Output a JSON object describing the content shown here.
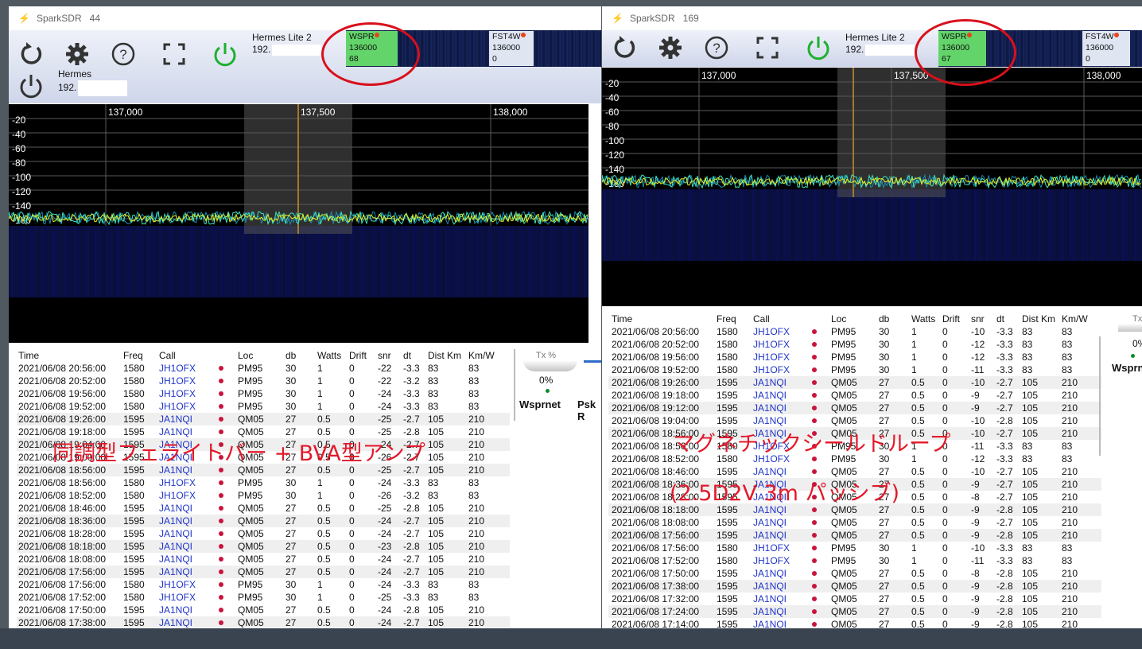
{
  "left": {
    "title": "SparkSDR",
    "title_num": "44",
    "radio1": {
      "name": "Hermes Lite 2",
      "ip": "192."
    },
    "radio2": {
      "name": "Hermes",
      "ip": "192."
    },
    "wspr": {
      "mode": "WSPR",
      "freq": "136000",
      "count": "68"
    },
    "fst4w": {
      "mode": "FST4W",
      "freq": "136000",
      "count": "0"
    },
    "freq_labels": [
      "137,000",
      "137,500",
      "138,000"
    ],
    "db_labels": [
      "-20",
      "-40",
      "-60",
      "-80",
      "-100",
      "-120",
      "-140",
      "-160"
    ],
    "headers": [
      "Time",
      "Freq",
      "Call",
      "Loc",
      "db",
      "Watts",
      "Drift",
      "snr",
      "dt",
      "Dist Km",
      "Km/W"
    ],
    "rows": [
      [
        "2021/06/08 20:56:00",
        "1580",
        "JH1OFX",
        "PM95",
        "30",
        "1",
        "0",
        "-22",
        "-3.3",
        "83",
        "83"
      ],
      [
        "2021/06/08 20:52:00",
        "1580",
        "JH1OFX",
        "PM95",
        "30",
        "1",
        "0",
        "-22",
        "-3.2",
        "83",
        "83"
      ],
      [
        "2021/06/08 19:56:00",
        "1580",
        "JH1OFX",
        "PM95",
        "30",
        "1",
        "0",
        "-24",
        "-3.3",
        "83",
        "83"
      ],
      [
        "2021/06/08 19:52:00",
        "1580",
        "JH1OFX",
        "PM95",
        "30",
        "1",
        "0",
        "-24",
        "-3.3",
        "83",
        "83"
      ],
      [
        "2021/06/08 19:26:00",
        "1595",
        "JA1NQI",
        "QM05",
        "27",
        "0.5",
        "0",
        "-25",
        "-2.7",
        "105",
        "210"
      ],
      [
        "2021/06/08 19:18:00",
        "1595",
        "JA1NQI",
        "QM05",
        "27",
        "0.5",
        "0",
        "-25",
        "-2.8",
        "105",
        "210"
      ],
      [
        "2021/06/08 19:04:00",
        "1595",
        "JA1NQI",
        "QM05",
        "27",
        "0.5",
        "0",
        "-24",
        "-2.7",
        "105",
        "210"
      ],
      [
        "2021/06/08 19:00:00",
        "1595",
        "JA1NQI",
        "QM05",
        "27",
        "0.5",
        "0",
        "-26",
        "-2.7",
        "105",
        "210"
      ],
      [
        "2021/06/08 18:56:00",
        "1595",
        "JA1NQI",
        "QM05",
        "27",
        "0.5",
        "0",
        "-25",
        "-2.7",
        "105",
        "210"
      ],
      [
        "2021/06/08 18:56:00",
        "1580",
        "JH1OFX",
        "PM95",
        "30",
        "1",
        "0",
        "-24",
        "-3.3",
        "83",
        "83"
      ],
      [
        "2021/06/08 18:52:00",
        "1580",
        "JH1OFX",
        "PM95",
        "30",
        "1",
        "0",
        "-26",
        "-3.2",
        "83",
        "83"
      ],
      [
        "2021/06/08 18:46:00",
        "1595",
        "JA1NQI",
        "QM05",
        "27",
        "0.5",
        "0",
        "-25",
        "-2.8",
        "105",
        "210"
      ],
      [
        "2021/06/08 18:36:00",
        "1595",
        "JA1NQI",
        "QM05",
        "27",
        "0.5",
        "0",
        "-24",
        "-2.7",
        "105",
        "210"
      ],
      [
        "2021/06/08 18:28:00",
        "1595",
        "JA1NQI",
        "QM05",
        "27",
        "0.5",
        "0",
        "-24",
        "-2.7",
        "105",
        "210"
      ],
      [
        "2021/06/08 18:18:00",
        "1595",
        "JA1NQI",
        "QM05",
        "27",
        "0.5",
        "0",
        "-23",
        "-2.8",
        "105",
        "210"
      ],
      [
        "2021/06/08 18:08:00",
        "1595",
        "JA1NQI",
        "QM05",
        "27",
        "0.5",
        "0",
        "-24",
        "-2.7",
        "105",
        "210"
      ],
      [
        "2021/06/08 17:56:00",
        "1595",
        "JA1NQI",
        "QM05",
        "27",
        "0.5",
        "0",
        "-24",
        "-2.7",
        "105",
        "210"
      ],
      [
        "2021/06/08 17:56:00",
        "1580",
        "JH1OFX",
        "PM95",
        "30",
        "1",
        "0",
        "-24",
        "-3.3",
        "83",
        "83"
      ],
      [
        "2021/06/08 17:52:00",
        "1580",
        "JH1OFX",
        "PM95",
        "30",
        "1",
        "0",
        "-25",
        "-3.3",
        "83",
        "83"
      ],
      [
        "2021/06/08 17:50:00",
        "1595",
        "JA1NQI",
        "QM05",
        "27",
        "0.5",
        "0",
        "-24",
        "-2.8",
        "105",
        "210"
      ],
      [
        "2021/06/08 17:38:00",
        "1595",
        "JA1NQI",
        "QM05",
        "27",
        "0.5",
        "0",
        "-24",
        "-2.7",
        "105",
        "210"
      ]
    ],
    "tx_label": "Tx %",
    "tx_value": "0%",
    "wsprnet": "Wsprnet",
    "psk": "Psk R"
  },
  "right": {
    "title": "SparkSDR",
    "title_num": "169",
    "radio1": {
      "name": "Hermes Lite 2",
      "ip": "192."
    },
    "wspr": {
      "mode": "WSPR",
      "freq": "136000",
      "count": "67"
    },
    "fst4w": {
      "mode": "FST4W",
      "freq": "136000",
      "count": "0"
    },
    "freq_labels": [
      "137,000",
      "137,500",
      "138,000"
    ],
    "db_labels": [
      "-20",
      "-40",
      "-60",
      "-80",
      "-100",
      "-120",
      "-140",
      "-160"
    ],
    "headers": [
      "Time",
      "Freq",
      "Call",
      "Loc",
      "db",
      "Watts",
      "Drift",
      "snr",
      "dt",
      "Dist Km",
      "Km/W"
    ],
    "rows": [
      [
        "2021/06/08 20:56:00",
        "1580",
        "JH1OFX",
        "PM95",
        "30",
        "1",
        "0",
        "-10",
        "-3.3",
        "83",
        "83"
      ],
      [
        "2021/06/08 20:52:00",
        "1580",
        "JH1OFX",
        "PM95",
        "30",
        "1",
        "0",
        "-12",
        "-3.3",
        "83",
        "83"
      ],
      [
        "2021/06/08 19:56:00",
        "1580",
        "JH1OFX",
        "PM95",
        "30",
        "1",
        "0",
        "-12",
        "-3.3",
        "83",
        "83"
      ],
      [
        "2021/06/08 19:52:00",
        "1580",
        "JH1OFX",
        "PM95",
        "30",
        "1",
        "0",
        "-11",
        "-3.3",
        "83",
        "83"
      ],
      [
        "2021/06/08 19:26:00",
        "1595",
        "JA1NQI",
        "QM05",
        "27",
        "0.5",
        "0",
        "-10",
        "-2.7",
        "105",
        "210"
      ],
      [
        "2021/06/08 19:18:00",
        "1595",
        "JA1NQI",
        "QM05",
        "27",
        "0.5",
        "0",
        "-9",
        "-2.7",
        "105",
        "210"
      ],
      [
        "2021/06/08 19:12:00",
        "1595",
        "JA1NQI",
        "QM05",
        "27",
        "0.5",
        "0",
        "-9",
        "-2.7",
        "105",
        "210"
      ],
      [
        "2021/06/08 19:04:00",
        "1595",
        "JA1NQI",
        "QM05",
        "27",
        "0.5",
        "0",
        "-10",
        "-2.8",
        "105",
        "210"
      ],
      [
        "2021/06/08 18:56:00",
        "1595",
        "JA1NQI",
        "QM05",
        "27",
        "0.5",
        "0",
        "-10",
        "-2.7",
        "105",
        "210"
      ],
      [
        "2021/06/08 18:56:00",
        "1580",
        "JH1OFX",
        "PM95",
        "30",
        "1",
        "0",
        "-11",
        "-3.3",
        "83",
        "83"
      ],
      [
        "2021/06/08 18:52:00",
        "1580",
        "JH1OFX",
        "PM95",
        "30",
        "1",
        "0",
        "-12",
        "-3.3",
        "83",
        "83"
      ],
      [
        "2021/06/08 18:46:00",
        "1595",
        "JA1NQI",
        "QM05",
        "27",
        "0.5",
        "0",
        "-10",
        "-2.7",
        "105",
        "210"
      ],
      [
        "2021/06/08 18:36:00",
        "1595",
        "JA1NQI",
        "QM05",
        "27",
        "0.5",
        "0",
        "-9",
        "-2.7",
        "105",
        "210"
      ],
      [
        "2021/06/08 18:28:00",
        "1595",
        "JA1NQI",
        "QM05",
        "27",
        "0.5",
        "0",
        "-8",
        "-2.7",
        "105",
        "210"
      ],
      [
        "2021/06/08 18:18:00",
        "1595",
        "JA1NQI",
        "QM05",
        "27",
        "0.5",
        "0",
        "-9",
        "-2.8",
        "105",
        "210"
      ],
      [
        "2021/06/08 18:08:00",
        "1595",
        "JA1NQI",
        "QM05",
        "27",
        "0.5",
        "0",
        "-9",
        "-2.7",
        "105",
        "210"
      ],
      [
        "2021/06/08 17:56:00",
        "1595",
        "JA1NQI",
        "QM05",
        "27",
        "0.5",
        "0",
        "-9",
        "-2.8",
        "105",
        "210"
      ],
      [
        "2021/06/08 17:56:00",
        "1580",
        "JH1OFX",
        "PM95",
        "30",
        "1",
        "0",
        "-10",
        "-3.3",
        "83",
        "83"
      ],
      [
        "2021/06/08 17:52:00",
        "1580",
        "JH1OFX",
        "PM95",
        "30",
        "1",
        "0",
        "-11",
        "-3.3",
        "83",
        "83"
      ],
      [
        "2021/06/08 17:50:00",
        "1595",
        "JA1NQI",
        "QM05",
        "27",
        "0.5",
        "0",
        "-8",
        "-2.8",
        "105",
        "210"
      ],
      [
        "2021/06/08 17:38:00",
        "1595",
        "JA1NQI",
        "QM05",
        "27",
        "0.5",
        "0",
        "-9",
        "-2.8",
        "105",
        "210"
      ],
      [
        "2021/06/08 17:32:00",
        "1595",
        "JA1NQI",
        "QM05",
        "27",
        "0.5",
        "0",
        "-9",
        "-2.8",
        "105",
        "210"
      ],
      [
        "2021/06/08 17:24:00",
        "1595",
        "JA1NQI",
        "QM05",
        "27",
        "0.5",
        "0",
        "-9",
        "-2.8",
        "105",
        "210"
      ],
      [
        "2021/06/08 17:14:00",
        "1595",
        "JA1NQI",
        "QM05",
        "27",
        "0.5",
        "0",
        "-9",
        "-2.8",
        "105",
        "210"
      ]
    ],
    "tx_label": "Tx",
    "tx_value": "0%",
    "wsprnet": "Wsprn"
  },
  "annotations": {
    "left_caption": "同調型フェライトバー + BVA型アンプ",
    "right_caption1": "マグネチックシールドループ",
    "right_caption2": "(2.5D2V 3m パッシブ)"
  },
  "colors": {
    "call": "#1f34c8",
    "wspr_bg": "#62d46a",
    "annotation": "#e3192a",
    "mark": "#c8143c"
  }
}
